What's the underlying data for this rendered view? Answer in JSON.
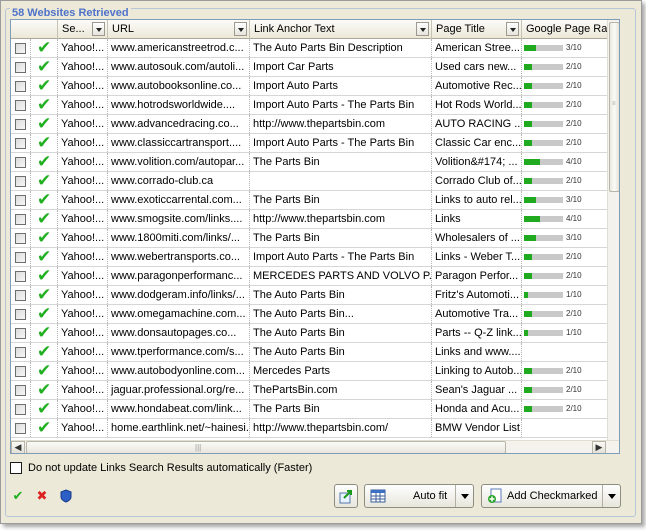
{
  "panel": {
    "title": "58 Websites Retrieved"
  },
  "columns": {
    "search_engine": "Se...",
    "url": "URL",
    "anchor": "Link Anchor Text",
    "page_title": "Page Title",
    "rank": "Google Page Rank"
  },
  "rows": [
    {
      "se": "Yahoo!...",
      "url": "www.americanstreetrod.c...",
      "anchor": "The Auto Parts Bin Description",
      "title": "American Stree...",
      "rank": 3,
      "rank_text": "3/10"
    },
    {
      "se": "Yahoo!...",
      "url": "www.autosouk.com/autoli...",
      "anchor": "Import Car Parts",
      "title": "Used cars new...",
      "rank": 2,
      "rank_text": "2/10"
    },
    {
      "se": "Yahoo!...",
      "url": "www.autobooksonline.co...",
      "anchor": "Import Auto Parts",
      "title": "Automotive Rec...",
      "rank": 2,
      "rank_text": "2/10"
    },
    {
      "se": "Yahoo!...",
      "url": "www.hotrodsworldwide....",
      "anchor": "Import Auto Parts - The Parts Bin",
      "title": "Hot Rods World...",
      "rank": 2,
      "rank_text": "2/10"
    },
    {
      "se": "Yahoo!...",
      "url": "www.advancedracing.co...",
      "anchor": "http://www.thepartsbin.com",
      "title": "AUTO RACING ...",
      "rank": 2,
      "rank_text": "2/10"
    },
    {
      "se": "Yahoo!...",
      "url": "www.classiccartransport....",
      "anchor": "Import Auto Parts - The Parts Bin",
      "title": "Classic Car enc...",
      "rank": 2,
      "rank_text": "2/10"
    },
    {
      "se": "Yahoo!...",
      "url": "www.volition.com/autopar...",
      "anchor": "The Parts Bin",
      "title": "Volition&#174; ...",
      "rank": 4,
      "rank_text": "4/10"
    },
    {
      "se": "Yahoo!...",
      "url": "www.corrado-club.ca",
      "anchor": "",
      "title": "Corrado Club of...",
      "rank": 2,
      "rank_text": "2/10"
    },
    {
      "se": "Yahoo!...",
      "url": "www.exoticcarrental.com...",
      "anchor": "The Parts Bin",
      "title": "Links to auto rel...",
      "rank": 3,
      "rank_text": "3/10"
    },
    {
      "se": "Yahoo!...",
      "url": "www.smogsite.com/links....",
      "anchor": "http://www.thepartsbin.com",
      "title": "Links",
      "rank": 4,
      "rank_text": "4/10"
    },
    {
      "se": "Yahoo!...",
      "url": "www.1800miti.com/links/...",
      "anchor": "The Parts Bin",
      "title": "Wholesalers of ...",
      "rank": 3,
      "rank_text": "3/10"
    },
    {
      "se": "Yahoo!...",
      "url": "www.webertransports.co...",
      "anchor": "Import Auto Parts - The Parts Bin",
      "title": "Links - Weber T...",
      "rank": 2,
      "rank_text": "2/10"
    },
    {
      "se": "Yahoo!...",
      "url": "www.paragonperformanc...",
      "anchor": "MERCEDES PARTS AND VOLVO P...",
      "title": "Paragon Perfor...",
      "rank": 2,
      "rank_text": "2/10"
    },
    {
      "se": "Yahoo!...",
      "url": "www.dodgeram.info/links/...",
      "anchor": "The Auto Parts Bin",
      "title": "Fritz's Automoti...",
      "rank": 1,
      "rank_text": "1/10"
    },
    {
      "se": "Yahoo!...",
      "url": "www.omegamachine.com...",
      "anchor": "The Auto Parts Bin...",
      "title": " Automotive Tra...",
      "rank": 2,
      "rank_text": "2/10"
    },
    {
      "se": "Yahoo!...",
      "url": "www.donsautopages.co...",
      "anchor": "The Auto Parts Bin",
      "title": "Parts -- Q-Z link...",
      "rank": 1,
      "rank_text": "1/10"
    },
    {
      "se": "Yahoo!...",
      "url": "www.tperformance.com/s...",
      "anchor": "The Auto Parts Bin",
      "title": "Links and www....",
      "rank": null,
      "rank_text": ""
    },
    {
      "se": "Yahoo!...",
      "url": "www.autobodyonline.com...",
      "anchor": "Mercedes Parts",
      "title": "Linking to Autob...",
      "rank": 2,
      "rank_text": "2/10"
    },
    {
      "se": "Yahoo!...",
      "url": "jaguar.professional.org/re...",
      "anchor": "ThePartsBin.com",
      "title": "Sean's Jaguar ...",
      "rank": 2,
      "rank_text": "2/10"
    },
    {
      "se": "Yahoo!...",
      "url": "www.hondabeat.com/link...",
      "anchor": "The Parts Bin",
      "title": "Honda and Acu...",
      "rank": 2,
      "rank_text": "2/10"
    },
    {
      "se": "Yahoo!...",
      "url": "home.earthlink.net/~hainesi...",
      "anchor": "http://www.thepartsbin.com/",
      "title": "BMW Vendor List",
      "rank": null,
      "rank_text": ""
    }
  ],
  "options": {
    "no_update_label": "Do not update Links Search Results automatically (Faster)"
  },
  "buttons": {
    "auto_fit": "Auto fit",
    "add_checkmarked": "Add Checkmarked"
  },
  "icons": {
    "check_all": "green-check-icon",
    "remove": "red-x-icon",
    "blue": "blue-shield-icon",
    "export": "export-arrow-icon",
    "autofit": "grid-icon",
    "add": "add-page-icon"
  },
  "colors": {
    "accent": "#4f72c9",
    "rank_fill": "#1faa1f",
    "tick": "#22b022"
  }
}
